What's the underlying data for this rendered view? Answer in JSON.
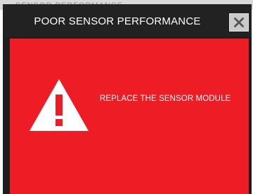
{
  "background": {
    "partial_text": "SENSOR PERFORMANCE"
  },
  "dialog": {
    "title": "POOR SENSOR PERFORMANCE",
    "close_icon": "close-icon",
    "message": "REPLACE THE SENSOR MODULE",
    "warning_icon": "warning-triangle-icon"
  },
  "colors": {
    "titlebar": "#222222",
    "panel": "#ee1c25",
    "text": "#ffffff",
    "close_button": "#c9c9c9"
  }
}
